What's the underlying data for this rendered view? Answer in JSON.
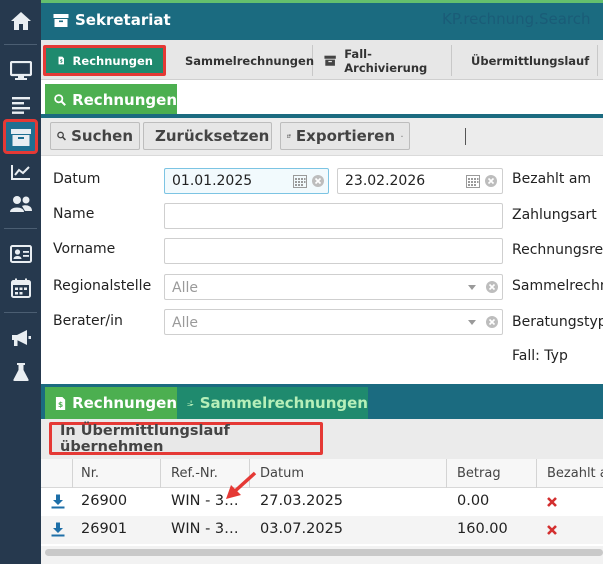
{
  "app": {
    "title": "Sekretariat"
  },
  "sidebar": {
    "items": [
      {
        "icon": "home-icon"
      },
      {
        "icon": "monitor-icon"
      },
      {
        "icon": "list-icon"
      },
      {
        "icon": "archive-icon",
        "active": true
      },
      {
        "icon": "chart-icon"
      },
      {
        "icon": "users-icon"
      },
      {
        "icon": "contact-card-icon"
      },
      {
        "icon": "calendar-icon"
      },
      {
        "icon": "megaphone-icon"
      },
      {
        "icon": "flask-icon"
      }
    ]
  },
  "topnav": {
    "tabs": [
      {
        "label": "Rechnungen",
        "icon": "invoice-icon",
        "active": true
      },
      {
        "label": "Sammelrechnungen",
        "icon": "hand-money-icon"
      },
      {
        "label": "Fall-Archivierung",
        "icon": "archive-icon"
      },
      {
        "label": "Übermittlungslauf",
        "icon": "archive-icon"
      }
    ]
  },
  "search": {
    "panel_title": "Rechnungen",
    "toolbar": {
      "search_label": "Suchen",
      "reset_label": "Zurücksetzen",
      "export_label": "Exportieren",
      "search_key": "KP.rechnung.Search"
    },
    "fields": {
      "datum_label": "Datum",
      "datum_from": "01.01.2025",
      "datum_to": "23.02.2026",
      "name_label": "Name",
      "vorname_label": "Vorname",
      "regionalstelle_label": "Regionalstelle",
      "regionalstelle_value": "Alle",
      "berater_label": "Berater/in",
      "berater_value": "Alle",
      "bezahlt_am_label": "Bezahlt am",
      "zahlungsart_label": "Zahlungsart",
      "rechnungsref_label": "Rechnungsrefe",
      "sammelrechnung_label": "Sammelrechnu",
      "beratungstyp_label": "Beratungstyp",
      "fall_typ_label": "Fall: Typ"
    }
  },
  "results": {
    "tabs": [
      {
        "label": "Rechnungen",
        "icon": "invoice-icon",
        "active": true
      },
      {
        "label": "Sammelrechnungen",
        "icon": "hand-money-icon"
      }
    ],
    "action_label": "In Übermittlungslauf übernehmen",
    "columns": [
      "Nr.",
      "Ref.-Nr.",
      "Datum",
      "Betrag",
      "Bezahlt a"
    ],
    "rows": [
      {
        "nr": "26900",
        "ref": "WIN - 3…",
        "datum": "27.03.2025",
        "betrag": "0.00",
        "bezahlt": false
      },
      {
        "nr": "26901",
        "ref": "WIN - 3…",
        "datum": "03.07.2025",
        "betrag": "160.00",
        "bezahlt": false
      }
    ]
  },
  "colors": {
    "sidebar": "#26394e",
    "header": "#1b6b80",
    "accent_green": "#4caf50",
    "highlight_red": "#e53935",
    "cross_red": "#d32f2f"
  }
}
